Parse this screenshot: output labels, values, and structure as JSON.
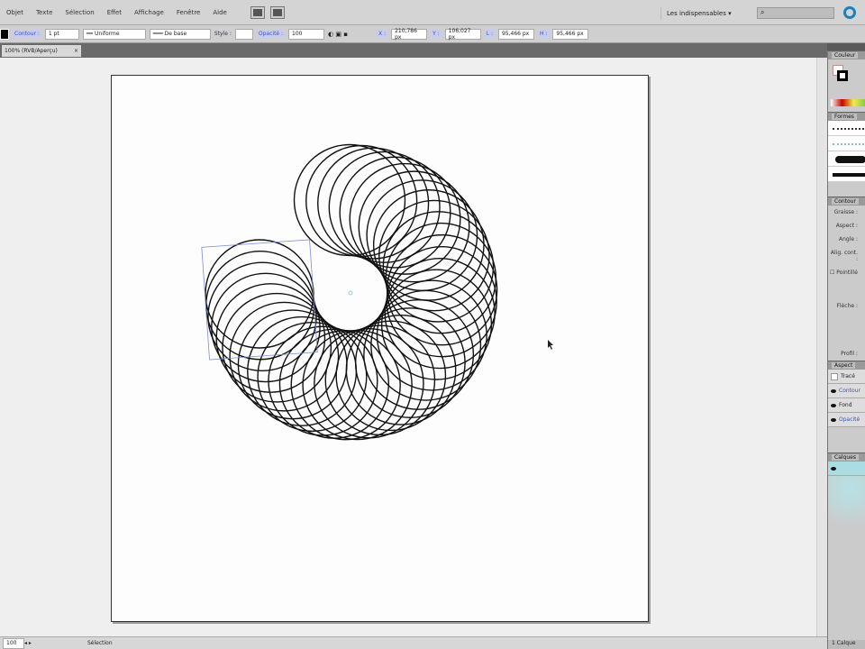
{
  "menubar": {
    "items": [
      "Objet",
      "Texte",
      "Sélection",
      "Effet",
      "Affichage",
      "Fenêtre",
      "Aide"
    ],
    "workspace": "Les indispensables",
    "search_placeholder": ""
  },
  "controlbar": {
    "stroke_label": "Contour :",
    "stroke_weight": "1 pt",
    "profile": "Uniforme",
    "brush": "De base",
    "style_label": "Style :",
    "opacity_label": "Opacité :",
    "opacity": "100",
    "x_label": "X :",
    "x": "210,786 px",
    "y_label": "Y :",
    "y": "106,027 px",
    "w_label": "L :",
    "w": "95,466 px",
    "h_label": "H :",
    "h": "95,466 px"
  },
  "document": {
    "tab_title": "100% (RVB/Aperçu)",
    "close": "×"
  },
  "panels": {
    "color": {
      "title": "Couleur"
    },
    "brushes": {
      "title": "Formes"
    },
    "stroke": {
      "title": "Contour",
      "rows": [
        "Graisse :",
        "Aspect :",
        "Angle :",
        "Alig. cont. :"
      ],
      "dashed": "Pointillé",
      "arrows": "Flèche :",
      "profile": "Profil :"
    },
    "appearance": {
      "title": "Aspect",
      "rows": [
        "Tracé",
        "Contour",
        "Fond",
        "Opacité"
      ]
    },
    "layers": {
      "title": "Calques",
      "footer": "1 Calque"
    }
  },
  "statusbar": {
    "zoom": "100",
    "tool": "Sélection"
  }
}
